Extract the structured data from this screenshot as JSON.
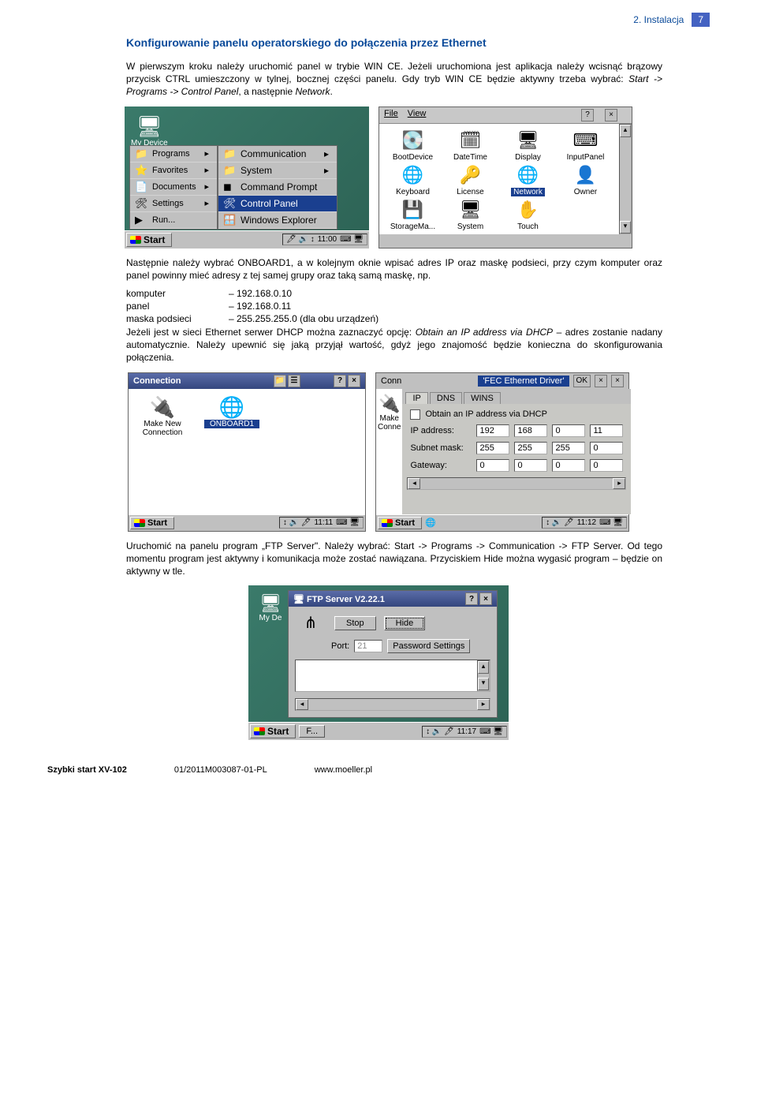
{
  "header": {
    "section": "2. Instalacja",
    "page": "7"
  },
  "title": "Konfigurowanie panelu operatorskiego do połączenia przez Ethernet",
  "para1_a": "W pierwszym kroku należy uruchomić panel w trybie WIN CE. Jeżeli uruchomiona jest aplikacja należy wcisnąć brązowy przycisk CTRL umieszczony w tylnej, bocznej części panelu. Gdy tryb WIN CE będzie aktywny trzeba wybrać: ",
  "para1_em": "Start -> Programs -> Control Panel",
  "para1_b": ", a następnie ",
  "para1_em2": "Network",
  "para1_c": ".",
  "shot1": {
    "desktop_icon": "My Device",
    "start": "Start",
    "time": "11:00",
    "menu": [
      {
        "lbl": "Programs",
        "ico": "📁"
      },
      {
        "lbl": "Favorites",
        "ico": "⭐"
      },
      {
        "lbl": "Documents",
        "ico": "📄"
      },
      {
        "lbl": "Settings",
        "ico": "🛠"
      },
      {
        "lbl": "Run...",
        "ico": "▶"
      }
    ],
    "submenu": [
      {
        "lbl": "Communication",
        "ico": "📁",
        "ar": "▸"
      },
      {
        "lbl": "System",
        "ico": "📁",
        "ar": "▸"
      },
      {
        "lbl": "Command Prompt",
        "ico": "◼"
      },
      {
        "lbl": "Control Panel",
        "ico": "🛠",
        "sel": true
      },
      {
        "lbl": "Windows Explorer",
        "ico": "🪟"
      }
    ],
    "cp_menu_file": "File",
    "cp_menu_view": "View",
    "cp_icons": [
      {
        "ico": "💽",
        "lbl": "BootDevice"
      },
      {
        "ico": "🗓",
        "lbl": "DateTime"
      },
      {
        "ico": "🖥",
        "lbl": "Display"
      },
      {
        "ico": "⌨",
        "lbl": "InputPanel"
      },
      {
        "ico": "🌐",
        "lbl": "Keyboard"
      },
      {
        "ico": "🔑",
        "lbl": "License"
      },
      {
        "ico": "🌐",
        "lbl": "Network",
        "sel": true
      },
      {
        "ico": "👤",
        "lbl": "Owner"
      },
      {
        "ico": "💾",
        "lbl": "StorageMa..."
      },
      {
        "ico": "🖥",
        "lbl": "System"
      },
      {
        "ico": "✋",
        "lbl": "Touch"
      }
    ]
  },
  "para2": "Następnie należy wybrać ONBOARD1, a w kolejnym oknie wpisać adres IP oraz maskę podsieci, przy czym komputer oraz panel powinny mieć adresy z tej samej grupy oraz taką samą maskę, np.",
  "kv": [
    {
      "k": "komputer",
      "v": "– 192.168.0.10"
    },
    {
      "k": "panel",
      "v": "– 192.168.0.11"
    },
    {
      "k": "maska podsieci",
      "v": "– 255.255.255.0 (dla obu urządzeń)"
    }
  ],
  "para3_a": "Jeżeli jest w sieci Ethernet serwer DHCP można zaznaczyć opcję: ",
  "para3_em": "Obtain an IP address via DHCP",
  "para3_b": " – adres zostanie nadany automatycznie. Należy upewnić się jaką przyjął wartość, gdyż jego znajomość będzie konieczna do skonfigurowania połączenia.",
  "shot2": {
    "left": {
      "title": "Connection",
      "icons": [
        {
          "ico": "🔌",
          "lbl": "Make New Connection"
        },
        {
          "ico": "🌐",
          "lbl": "ONBOARD1",
          "sel": true
        }
      ],
      "start": "Start",
      "time": "11:11"
    },
    "right": {
      "title_prefix": "Conn",
      "driver": "'FEC Ethernet Driver'",
      "ok": "OK",
      "tabs": [
        "IP",
        "DNS",
        "WINS"
      ],
      "sidebar_icon": "🔌",
      "sidebar_make": "Make",
      "sidebar_conn": "Conne",
      "cb_lbl": "Obtain an IP address via DHCP",
      "rows": [
        {
          "lbl": "IP address:",
          "v": [
            "192",
            "168",
            "0",
            "11"
          ]
        },
        {
          "lbl": "Subnet mask:",
          "v": [
            "255",
            "255",
            "255",
            "0"
          ]
        },
        {
          "lbl": "Gateway:",
          "v": [
            "0",
            "0",
            "0",
            "0"
          ]
        }
      ],
      "start": "Start",
      "time": "11:12"
    }
  },
  "para4": "Uruchomić na panelu program „FTP Server\". Należy wybrać: Start -> Programs -> Communication -> FTP Server. Od tego momentu program jest aktywny i komunikacja może zostać nawiązana. Przyciskiem Hide można wygasić program – będzie on aktywny w tle.",
  "shot3": {
    "desk_icon": "My De",
    "title": "FTP Server V2.22.1",
    "btn_stop": "Stop",
    "btn_hide": "Hide",
    "port_lbl": "Port:",
    "port_val": "21",
    "btn_pwd": "Password Settings",
    "start": "Start",
    "task": "F...",
    "time": "11:17"
  },
  "footer": {
    "left": "Szybki start XV-102",
    "mid": "01/2011M003087-01-PL",
    "right": "www.moeller.pl"
  }
}
